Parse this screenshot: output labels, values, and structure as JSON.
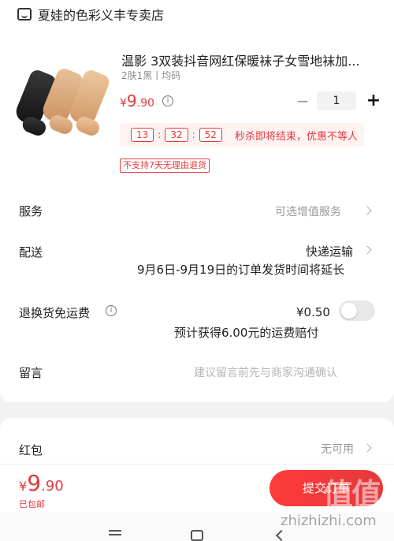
{
  "shop": {
    "icon": "store-icon",
    "name": "夏娃的色彩义丰专卖店"
  },
  "product": {
    "title": "温影 3双装抖音网红保暖袜子女雪地袜加...",
    "spec": "2肤1黑丨均码",
    "price_symbol": "¥",
    "price_int": "9",
    "price_dec": ".90",
    "quantity": "1",
    "minus": "−",
    "plus": "+",
    "countdown": {
      "h": "13",
      "m": "32",
      "s": "52",
      "sep": ":",
      "text": "秒杀即将结束，优惠不等人"
    },
    "no_return": "不支持7天无理由退货"
  },
  "rows": {
    "service": {
      "label": "服务",
      "value": "可选增值服务"
    },
    "delivery": {
      "label": "配送",
      "value": "快递运输",
      "note": "9月6日-9月19日的订单发货时间将延长"
    },
    "return": {
      "label": "退换货免运费",
      "price": "¥0.50",
      "note": "预计获得6.00元的运费赔付",
      "enabled": false
    },
    "memo": {
      "label": "留言",
      "placeholder": "建议留言前先与商家沟通确认"
    },
    "redpack": {
      "label": "红包",
      "value": "无可用"
    }
  },
  "footer": {
    "total_symbol": "¥",
    "total_int": "9",
    "total_dec": ".90",
    "free_shipping": "已包邮",
    "submit": "提交订单"
  },
  "watermark": {
    "logo": "值|值|值",
    "url": "zhizhizhi.com"
  },
  "colors": {
    "accent": "#e4393c",
    "bg": "#f2f2f2"
  }
}
